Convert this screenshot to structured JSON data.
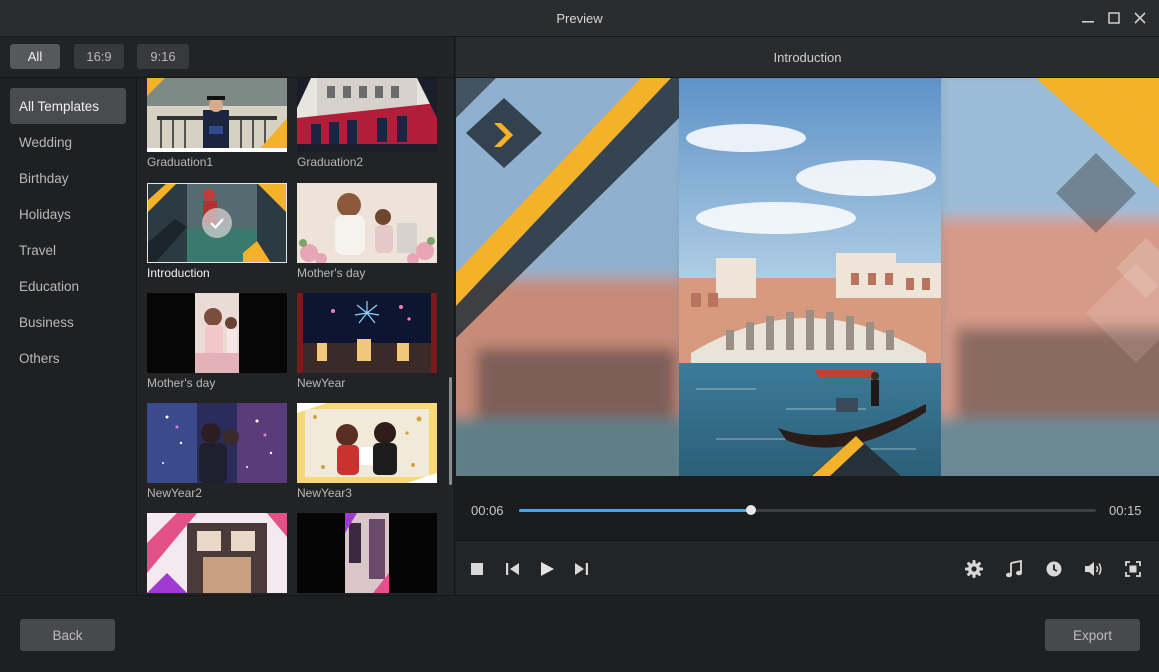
{
  "window": {
    "title": "Preview"
  },
  "ratio_tabs": [
    "All",
    "16:9",
    "9:16"
  ],
  "categories": [
    "All Templates",
    "Wedding",
    "Birthday",
    "Holidays",
    "Travel",
    "Education",
    "Business",
    "Others"
  ],
  "templates": [
    {
      "label": "Graduation1"
    },
    {
      "label": "Graduation2"
    },
    {
      "label": "Introduction",
      "selected": true
    },
    {
      "label": "Mother's day"
    },
    {
      "label": "Mother's day"
    },
    {
      "label": "NewYear"
    },
    {
      "label": "NewYear2"
    },
    {
      "label": "NewYear3"
    },
    {
      "label": ""
    },
    {
      "label": ""
    }
  ],
  "preview": {
    "title": "Introduction",
    "current_time": "00:06",
    "total_time": "00:15",
    "progress_fraction": 0.402
  },
  "footer": {
    "back_label": "Back",
    "export_label": "Export"
  },
  "colors": {
    "accent_blue": "#4aa7e6",
    "template_yellow": "#f4b12a"
  }
}
